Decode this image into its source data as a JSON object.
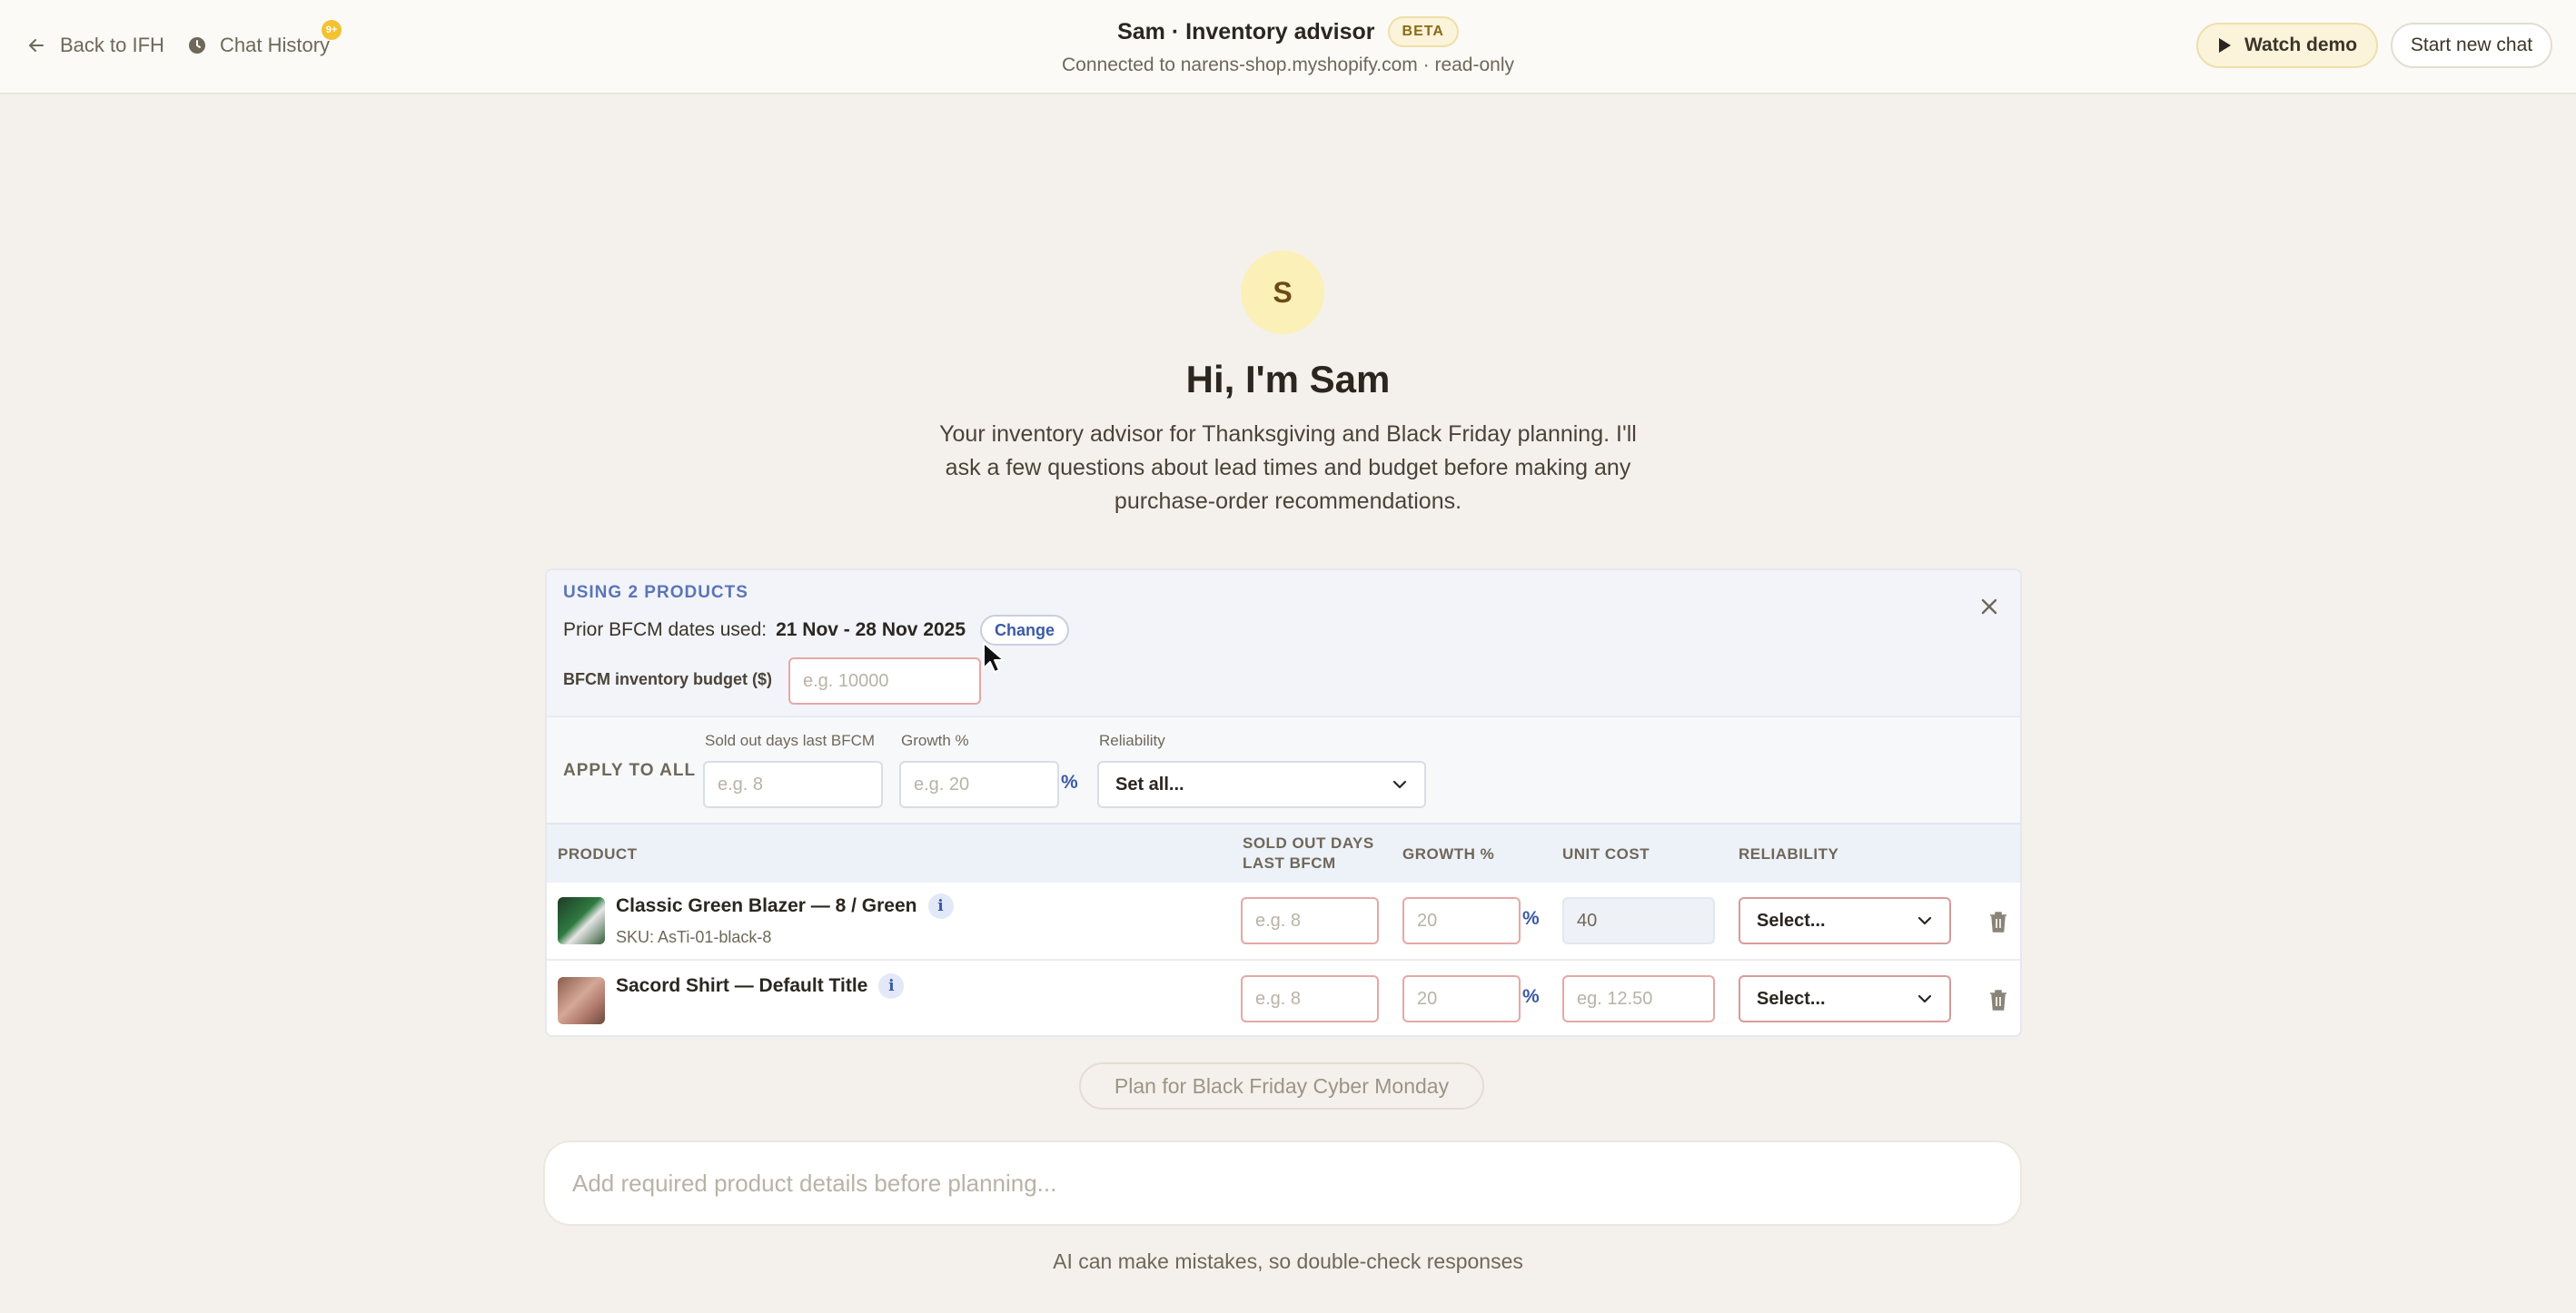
{
  "header": {
    "back_label": "Back to IFH",
    "history_label": "Chat History",
    "history_badge": "9+",
    "title": "Sam · Inventory advisor",
    "beta": "BETA",
    "subtitle": "Connected to narens-shop.myshopify.com · read-only",
    "watch_demo": "Watch demo",
    "new_chat": "Start new chat"
  },
  "hero": {
    "avatar_letter": "S",
    "title": "Hi, I'm Sam",
    "description": "Your inventory advisor for Thanksgiving and Black Friday planning. I'll ask a few questions about lead times and budget before making any purchase-order recommendations."
  },
  "panel": {
    "using_label": "USING 2 PRODUCTS",
    "dates_prefix": "Prior BFCM dates used:",
    "dates_value": "21 Nov - 28 Nov 2025",
    "change_label": "Change",
    "budget_label": "BFCM inventory budget ($)",
    "budget_placeholder": "e.g. 10000",
    "apply_all": {
      "label": "APPLY TO ALL",
      "sold_out_label": "Sold out days last BFCM",
      "sold_out_placeholder": "e.g. 8",
      "growth_label": "Growth %",
      "growth_placeholder": "e.g. 20",
      "pct": "%",
      "reliability_label": "Reliability",
      "reliability_value": "Set all..."
    },
    "table": {
      "headers": {
        "product": "PRODUCT",
        "sold_out_line1": "SOLD OUT DAYS",
        "sold_out_line2": "LAST BFCM",
        "growth": "GROWTH %",
        "unit_cost": "UNIT COST",
        "reliability": "RELIABILITY"
      },
      "rows": [
        {
          "name": "Classic Green Blazer — 8 / Green",
          "sku": "SKU: AsTi-01-black-8",
          "sold_out_placeholder": "e.g. 8",
          "growth_placeholder": "20",
          "pct": "%",
          "unit_cost_placeholder": "40",
          "reliability": "Select..."
        },
        {
          "name": "Sacord Shirt — Default Title",
          "sold_out_placeholder": "e.g. 8",
          "growth_placeholder": "20",
          "pct": "%",
          "unit_cost_placeholder": "eg. 12.50",
          "reliability": "Select..."
        }
      ]
    }
  },
  "footer": {
    "plan_button": "Plan for Black Friday Cyber Monday",
    "chat_placeholder": "Add required product details before planning...",
    "disclaimer": "AI can make mistakes, so double-check responses"
  },
  "icons": {
    "back": "arrow-left-icon",
    "history": "clock-icon",
    "watch": "play-icon",
    "close": "close-icon",
    "chevron": "chevron-down-icon",
    "info": "info-icon",
    "trash": "trash-icon"
  },
  "colors": {
    "background": "#f4f1ec",
    "accent_blue": "#3a5aa6",
    "beta_yellow": "#fbf3da",
    "error_border": "#e7a6a6"
  }
}
